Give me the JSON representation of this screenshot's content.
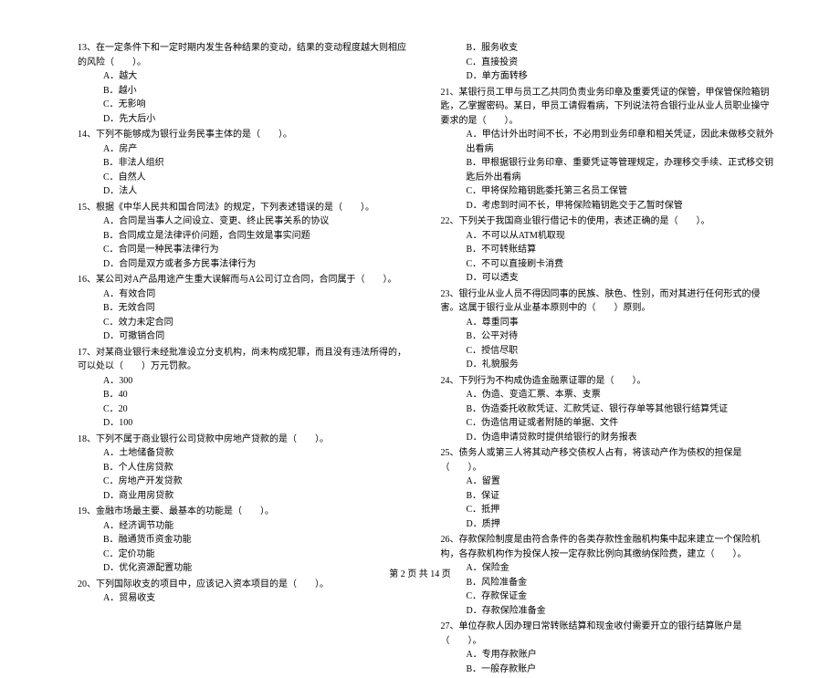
{
  "left": {
    "q13": {
      "text": "13、在一定条件下和一定时期内发生各种结果的变动，结果的变动程度越大则相应的风险（　　）。",
      "a": "A．越大",
      "b": "B．越小",
      "c": "C．无影响",
      "d": "D．先大后小"
    },
    "q14": {
      "text": "14、下列不能够成为银行业务民事主体的是（　　）。",
      "a": "A．房产",
      "b": "B．非法人组织",
      "c": "C．自然人",
      "d": "D．法人"
    },
    "q15": {
      "text": "15、根据《中华人民共和国合同法》的规定，下列表述错误的是（　　）。",
      "a": "A．合同是当事人之间设立、变更、终止民事关系的协议",
      "b": "B．合同成立是法律评价问题，合同生效是事实问题",
      "c": "C．合同是一种民事法律行为",
      "d": "D．合同是双方或者多方民事法律行为"
    },
    "q16": {
      "text": "16、某公司对A产品用途产生重大误解而与A公司订立合同，合同属于（　　）。",
      "a": "A．有效合同",
      "b": "B．无效合同",
      "c": "C．效力未定合同",
      "d": "D．可撤销合同"
    },
    "q17": {
      "text": "17、对某商业银行未经批准设立分支机构，尚未构成犯罪，而且没有违法所得的，可以处以（　　）万元罚款。",
      "a": "A．300",
      "b": "B．40",
      "c": "C．20",
      "d": "D．100"
    },
    "q18": {
      "text": "18、下列不属于商业银行公司贷款中房地产贷款的是（　　）。",
      "a": "A．土地储备贷款",
      "b": "B．个人住房贷款",
      "c": "C．房地产开发贷款",
      "d": "D．商业用房贷款"
    },
    "q19": {
      "text": "19、金融市场最主要、最基本的功能是（　　）。",
      "a": "A．经济调节功能",
      "b": "B．融通货币资金功能",
      "c": "C．定价功能",
      "d": "D．优化资源配置功能"
    },
    "q20": {
      "text": "20、下列国际收支的项目中，应该记入资本项目的是（　　）。",
      "a": "A．贸易收支"
    }
  },
  "right": {
    "q20cont": {
      "b": "B．服务收支",
      "c": "C．直接投资",
      "d": "D．单方面转移"
    },
    "q21": {
      "text": "21、某银行员工甲与员工乙共同负责业务印章及重要凭证的保管，甲保管保险箱钥匙，乙掌握密码。某日，甲员工请假看病，下列说法符合银行业从业人员职业操守要求的是（　　）。",
      "a": "A．甲估计外出时间不长，不必用到业务印章和相关凭证，因此未做移交就外出看病",
      "b": "B．甲根据银行业务印章、重要凭证等管理规定，办理移交手续、正式移交钥匙后外出看病",
      "c": "C．甲将保险箱钥匙委托第三名员工保管",
      "d": "D．考虑到时间不长，甲将保险箱钥匙交于乙暂时保管"
    },
    "q22": {
      "text": "22、下列关于我国商业银行借记卡的使用，表述正确的是（　　）。",
      "a": "A．不可以从ATM机取现",
      "b": "B．不可转账结算",
      "c": "C．不可以直接刷卡消费",
      "d": "D．可以透支"
    },
    "q23": {
      "text": "23、银行业从业人员不得因同事的民族、肤色、性别，而对其进行任何形式的侵害。这属于银行业从业基本原则中的（　　）原则。",
      "a": "A．尊重同事",
      "b": "B．公平对待",
      "c": "C．授信尽职",
      "d": "D．礼貌服务"
    },
    "q24": {
      "text": "24、下列行为不构成伪造金融票证罪的是（　　）。",
      "a": "A．伪造、变造汇票、本票、支票",
      "b": "B．伪造委托收款凭证、汇款凭证、银行存单等其他银行结算凭证",
      "c": "C．伪造信用证或者附随的单据、文件",
      "d": "D．伪造申请贷款时提供给银行的财务报表"
    },
    "q25": {
      "text": "25、债务人或第三人将其动产移交债权人占有，将该动产作为债权的担保是（　　）。",
      "a": "A．留置",
      "b": "B．保证",
      "c": "C．抵押",
      "d": "D．质押"
    },
    "q26": {
      "text": "26、存款保险制度是由符合条件的各类存款性金融机构集中起来建立一个保险机构，各存款机构作为投保人按一定存款比例向其缴纳保险费，建立（　　）。",
      "a": "A．保险金",
      "b": "B．风险准备金",
      "c": "C．存款保证金",
      "d": "D．存款保险准备金"
    },
    "q27": {
      "text": "27、单位存款人因办理日常转账结算和现金收付需要开立的银行结算账户是（　　）。",
      "a": "A．专用存款账户",
      "b": "B．一般存款账户"
    }
  },
  "footer": "第 2 页 共 14 页"
}
